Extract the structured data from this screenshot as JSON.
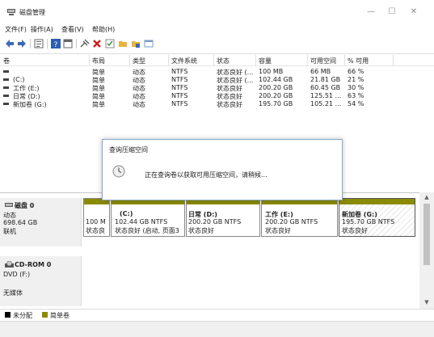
{
  "window": {
    "title": "磁盘管理",
    "minimize": "—",
    "maximize": "☐",
    "close": "✕"
  },
  "menu": [
    "文件(F)",
    "操作(A)",
    "查看(V)",
    "帮助(H)"
  ],
  "toolbar": {
    "icons": [
      "back-arrow-icon",
      "forward-arrow-icon",
      "list-view-icon",
      "help-icon",
      "properties-icon",
      "connect-icon",
      "delete-icon",
      "check-icon",
      "folder-icon",
      "open-icon",
      "refresh-icon"
    ]
  },
  "volume_table": {
    "columns": [
      "卷",
      "布局",
      "类型",
      "文件系统",
      "状态",
      "容量",
      "可用空间",
      "% 可用"
    ],
    "rows": [
      {
        "vol": "",
        "layout": "简单",
        "type": "动态",
        "fs": "NTFS",
        "status": "状态良好 (...",
        "capacity": "100 MB",
        "free": "66 MB",
        "pct": "66 %"
      },
      {
        "vol": "(C:)",
        "layout": "简单",
        "type": "动态",
        "fs": "NTFS",
        "status": "状态良好 (...",
        "capacity": "102.44 GB",
        "free": "21.81 GB",
        "pct": "21 %"
      },
      {
        "vol": "工作 (E:)",
        "layout": "简单",
        "type": "动态",
        "fs": "NTFS",
        "status": "状态良好",
        "capacity": "200.20 GB",
        "free": "60.45 GB",
        "pct": "30 %"
      },
      {
        "vol": "日常 (D:)",
        "layout": "简单",
        "type": "动态",
        "fs": "NTFS",
        "status": "状态良好",
        "capacity": "200.20 GB",
        "free": "125.51 ...",
        "pct": "63 %"
      },
      {
        "vol": "新加卷 (G:)",
        "layout": "简单",
        "type": "动态",
        "fs": "NTFS",
        "status": "状态良好",
        "capacity": "195.70 GB",
        "free": "105.21 ...",
        "pct": "54 %"
      }
    ]
  },
  "dialog": {
    "title": "查询压缩空间",
    "message": "正在查询卷以获取可用压缩空间，请稍候..."
  },
  "disk0": {
    "name": "磁盘 0",
    "type": "动态",
    "size": "698.64 GB",
    "state": "联机",
    "partitions": [
      {
        "line1": "100 M",
        "line2": "状态良",
        "bold": false
      },
      {
        "name": "(C:)",
        "line1": "102.44 GB NTFS",
        "line2": "状态良好 (启动, 页面3",
        "bold": true
      },
      {
        "name": "日常  (D:)",
        "line1": "200.20 GB NTFS",
        "line2": "状态良好",
        "bold": true
      },
      {
        "name": "工作  (E:)",
        "line1": "200.20 GB NTFS",
        "line2": "状态良好",
        "bold": true
      },
      {
        "name": "新加卷  (G:)",
        "line1": "195.70 GB NTFS",
        "line2": "状态良好",
        "bold": true
      }
    ]
  },
  "cdrom0": {
    "name": "CD-ROM 0",
    "type": "DVD (F:)",
    "state": "无媒体"
  },
  "legend": {
    "unallocated": "未分配",
    "simple": "简单卷"
  },
  "colors": {
    "partition_bar": "#8b8b00",
    "dialog_border": "#89a9c9",
    "legend_unallocated": "#000000",
    "legend_simple": "#8b8b00"
  }
}
